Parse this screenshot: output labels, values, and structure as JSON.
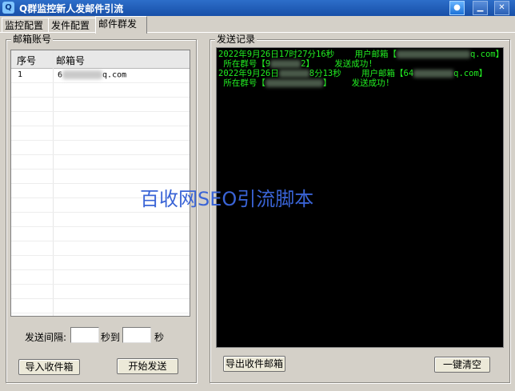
{
  "window": {
    "title": "Q群监控新人发邮件引流",
    "icon": "app-icon",
    "controls": {
      "min": "▁",
      "close": "✕"
    }
  },
  "tabs": [
    {
      "label": "监控配置"
    },
    {
      "label": "发件配置"
    },
    {
      "label": "邮件群发",
      "active": true
    }
  ],
  "left": {
    "group_title": "邮箱账号",
    "table": {
      "headers": [
        "序号",
        "邮箱号"
      ],
      "rows": [
        {
          "no": "1",
          "mail_prefix": "6",
          "mail_suffix": "q.com"
        }
      ]
    },
    "interval": {
      "label": "发送间隔:",
      "from_value": "",
      "to_label": "秒到",
      "to_value": "",
      "unit": "秒"
    },
    "import_button": "导入收件箱",
    "start_button": "开始发送"
  },
  "right": {
    "group_title": "发送记录",
    "log": [
      {
        "prefix": "2022年9月26日17时27分16秒",
        "mid": "    用户邮箱【",
        "suffix": "q.com】"
      },
      {
        "prefix": " 所在群号【9",
        "mid": "2】    发送成功!",
        "suffix": ""
      },
      {
        "prefix": "2022年9月26日",
        "mid": "8分13秒    用户邮箱【64",
        "suffix": "q.com】"
      },
      {
        "prefix": " 所在群号【",
        "mid": "】    发送成功!",
        "suffix": ""
      }
    ],
    "export_button": "导出收件邮箱",
    "clear_button": "一键清空"
  },
  "watermark": "百收网SEO引流脚本",
  "colors": {
    "titlebar": "#1e5fbf",
    "log_bg": "#000000",
    "log_text": "#22ee22",
    "watermark": "#3a64d6"
  }
}
